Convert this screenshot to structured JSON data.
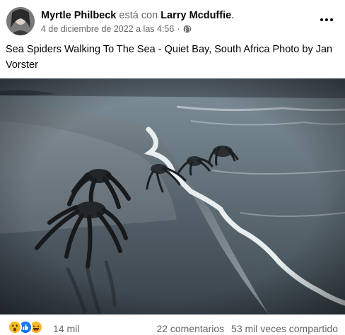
{
  "post": {
    "author": "Myrtle Philbeck",
    "with_text": "está con",
    "tagged": "Larry Mcduffie",
    "period": ".",
    "date": "4 de diciembre de 2022 a las 4:56",
    "separator": "·",
    "privacy_icon": "globe-icon",
    "more_icon": "more-options-icon",
    "caption": "Sea Spiders Walking To The Sea - Quiet Bay, South Africa Photo by Jan Vorster"
  },
  "stats": {
    "reactions": [
      "wow-reaction-icon",
      "like-reaction-icon",
      "haha-reaction-icon"
    ],
    "reaction_count": "14 mil",
    "comments": "22 comentarios",
    "shares": "53 mil veces compartido"
  },
  "colors": {
    "like_blue": "#1877f2",
    "reaction_yellow": "#f7b928",
    "secondary_text": "#65676b"
  }
}
